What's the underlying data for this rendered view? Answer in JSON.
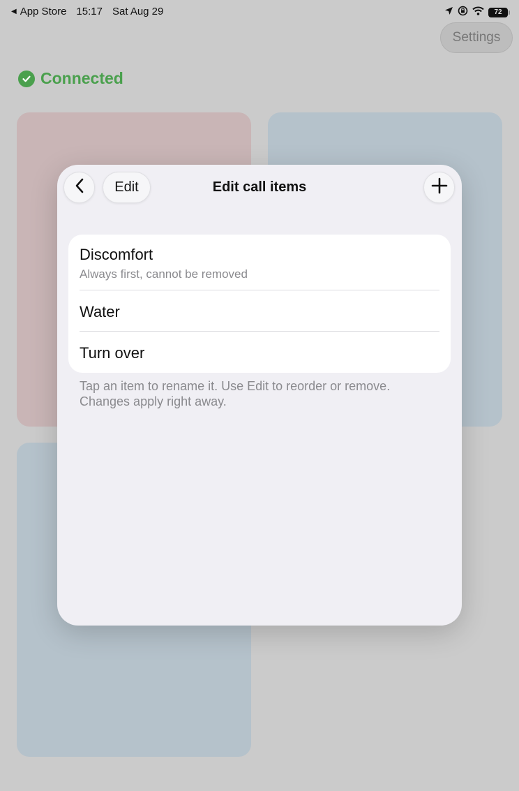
{
  "status_bar": {
    "back_app": "App Store",
    "time": "15:17",
    "date": "Sat Aug 29",
    "battery": "72",
    "icons": [
      "location-arrow-icon",
      "orientation-lock-icon",
      "wifi-icon",
      "battery-icon"
    ]
  },
  "settings_button": {
    "label": "Settings"
  },
  "connection": {
    "label": "Connected",
    "color": "#4aa04d",
    "icon": "check-circle-icon"
  },
  "background_cards": [
    {
      "name": "card-red",
      "color": "#c9b5b6"
    },
    {
      "name": "card-blue",
      "color": "#b5c2cb"
    },
    {
      "name": "card-blue-2",
      "color": "#b5c2cb"
    }
  ],
  "modal": {
    "title": "Edit call items",
    "edit_label": "Edit",
    "back_icon": "chevron-left-icon",
    "add_icon": "plus-icon",
    "items": [
      {
        "title": "Discomfort",
        "subtitle": "Always first, cannot be removed"
      },
      {
        "title": "Water"
      },
      {
        "title": "Turn over"
      }
    ],
    "footer": "Tap an item to rename it. Use Edit to reorder or remove. Changes apply right away."
  }
}
